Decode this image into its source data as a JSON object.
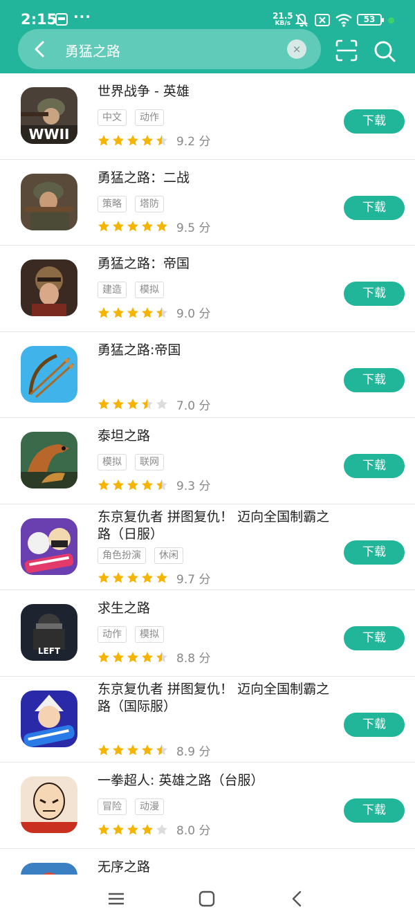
{
  "status_bar": {
    "time": "2:15",
    "dots": "···",
    "net_speed_value": "21.5",
    "net_speed_unit": "KB/s",
    "battery": "53",
    "icons": [
      "app-notification-icon",
      "mute-bell-icon",
      "no-sim-icon",
      "wifi-icon",
      "battery-icon"
    ]
  },
  "search": {
    "query": "勇猛之路",
    "clear_label": "×"
  },
  "download_label": "下载",
  "colors": {
    "accent": "#22b59b",
    "button": "#21b59a",
    "star": "#f5b400",
    "star_empty": "#dcdcdc"
  },
  "results": [
    {
      "title": "世界战争 - 英雄",
      "tags": [
        "中文",
        "动作"
      ],
      "rating": 4.5,
      "score": "9.2 分",
      "icon": "soldier-wwii-icon"
    },
    {
      "title": "勇猛之路：二战",
      "tags": [
        "策略",
        "塔防"
      ],
      "rating": 5,
      "score": "9.5 分",
      "icon": "soldier-rifle-icon"
    },
    {
      "title": "勇猛之路：帝国",
      "tags": [
        "建造",
        "模拟"
      ],
      "rating": 4.5,
      "score": "9.0 分",
      "icon": "warrior-helmet-icon"
    },
    {
      "title": "勇猛之路:帝国",
      "tags": [],
      "rating": 3.5,
      "score": "7.0 分",
      "icon": "bow-arrows-icon"
    },
    {
      "title": "泰坦之路",
      "tags": [
        "模拟",
        "联网"
      ],
      "rating": 4.5,
      "score": "9.3 分",
      "icon": "dinosaur-icon"
    },
    {
      "title": "东京复仇者 拼图复仇！ 迈向全国制霸之路（日服）",
      "tags": [
        "角色扮演",
        "休闲"
      ],
      "rating": 5,
      "score": "9.7 分",
      "icon": "anime-characters-icon"
    },
    {
      "title": "求生之路",
      "tags": [
        "动作",
        "模拟"
      ],
      "rating": 4.5,
      "score": "8.8 分",
      "icon": "left-to-survive-icon"
    },
    {
      "title": "东京复仇者 拼图复仇！ 迈向全国制霸之路（国际服）",
      "tags": [],
      "rating": 4.5,
      "score": "8.9 分",
      "icon": "new-event-anime-icon"
    },
    {
      "title": "一拳超人: 英雄之路（台服）",
      "tags": [
        "冒险",
        "动漫"
      ],
      "rating": 4,
      "score": "8.0 分",
      "icon": "bald-hero-icon"
    },
    {
      "title": "无序之路",
      "tags": [],
      "rating": null,
      "score": "",
      "icon": "partial-app-icon"
    }
  ],
  "nav_bar": {
    "items": [
      "menu-icon",
      "home-icon",
      "back-icon"
    ]
  }
}
